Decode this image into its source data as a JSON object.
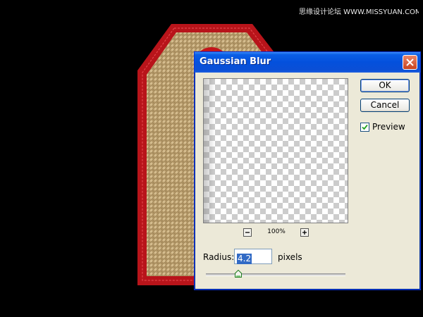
{
  "watermark": "思缘设计论坛 WWW.MISSYUAN.COM",
  "dialog": {
    "title": "Gaussian Blur",
    "ok_label": "OK",
    "cancel_label": "Cancel",
    "preview_label": "Preview",
    "preview_checked": true,
    "zoom_level": "100%",
    "radius_label": "Radius:",
    "radius_value": "4.2",
    "units": "pixels",
    "slider_fraction": 0.23
  },
  "colors": {
    "titlebar": "#0450dc",
    "dialog_bg": "#ece9d8",
    "tag_border": "#c4141b",
    "burlap": "#c4a878"
  },
  "icons": {
    "close": "close-icon",
    "zoom_out": "minus-icon",
    "zoom_in": "plus-icon",
    "check": "check-icon"
  }
}
